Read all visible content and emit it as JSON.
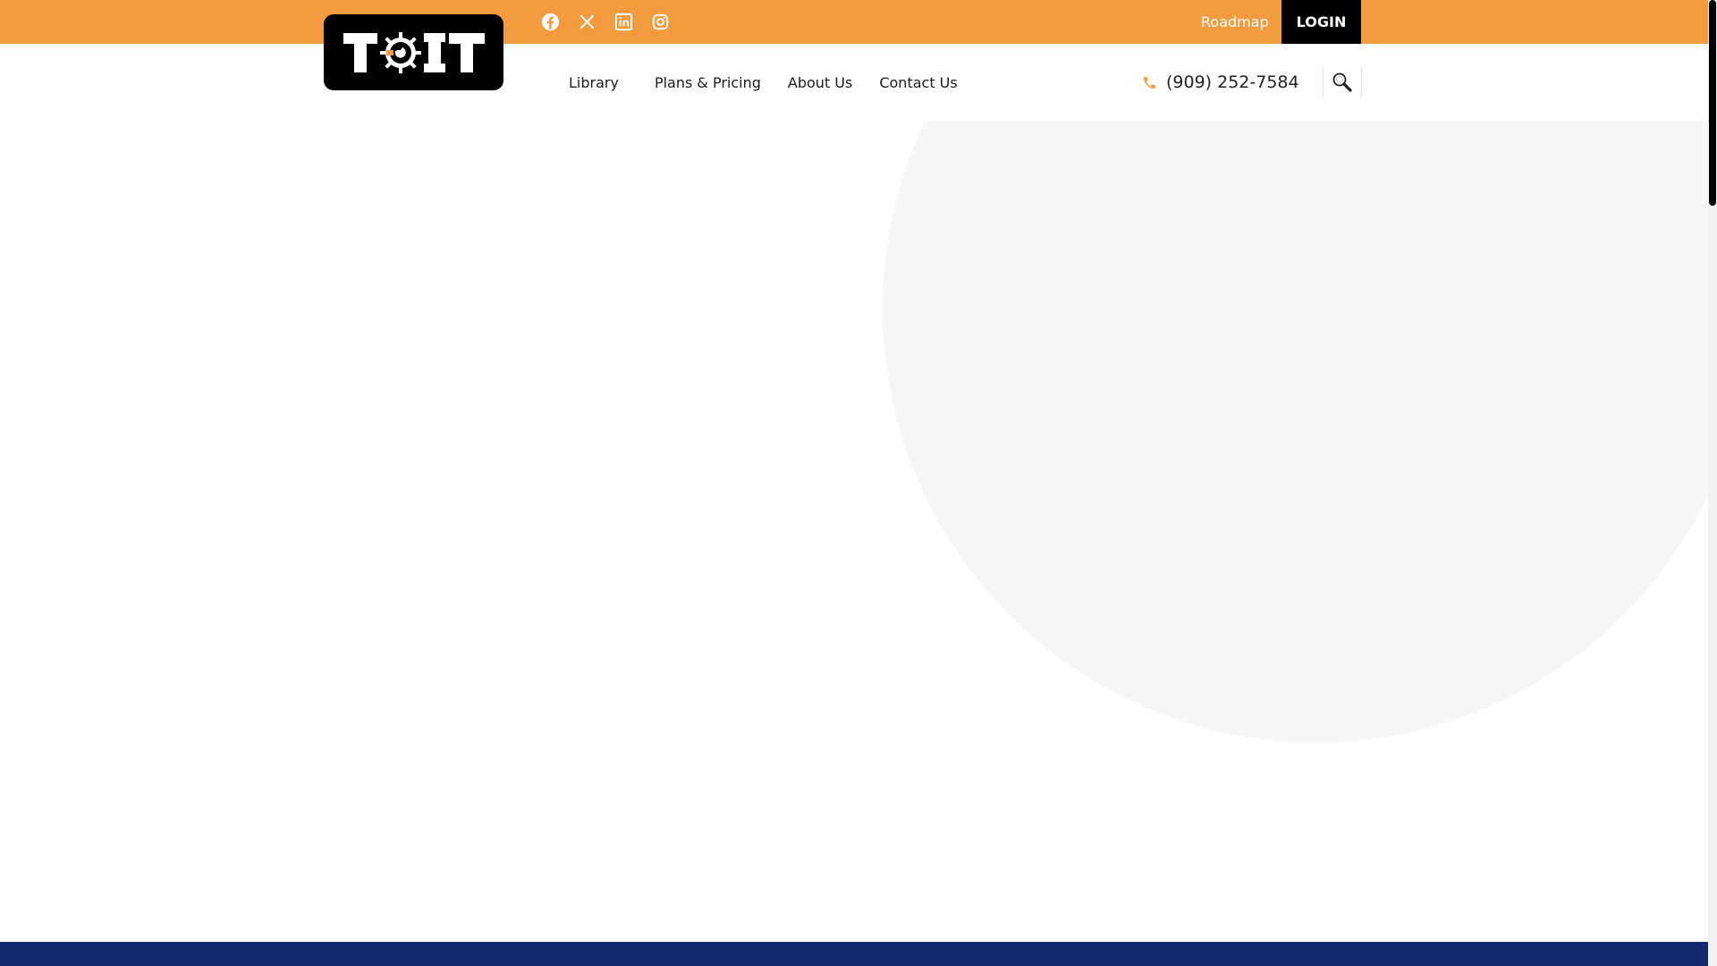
{
  "topbar": {
    "social": [
      {
        "name": "facebook-icon",
        "label": "Facebook"
      },
      {
        "name": "x-twitter-icon",
        "label": "X"
      },
      {
        "name": "linkedin-icon",
        "label": "LinkedIn"
      },
      {
        "name": "instagram-icon",
        "label": "Instagram"
      }
    ],
    "roadmap_label": "Roadmap",
    "login_label": "LOGIN",
    "background_color": "#f29b3f"
  },
  "logo": {
    "text": "T IT",
    "accent_color": "#f29b3f"
  },
  "nav": {
    "items": [
      {
        "label": "Library"
      },
      {
        "label": "Plans & Pricing"
      },
      {
        "label": "About Us"
      },
      {
        "label": "Contact Us"
      }
    ],
    "phone": "(909) 252-7584",
    "phone_icon": "phone-icon",
    "search_icon": "search-icon"
  },
  "colors": {
    "brand_orange": "#f29b3f",
    "footer_navy": "#12296e",
    "circle_gray": "#f6f6f6"
  }
}
